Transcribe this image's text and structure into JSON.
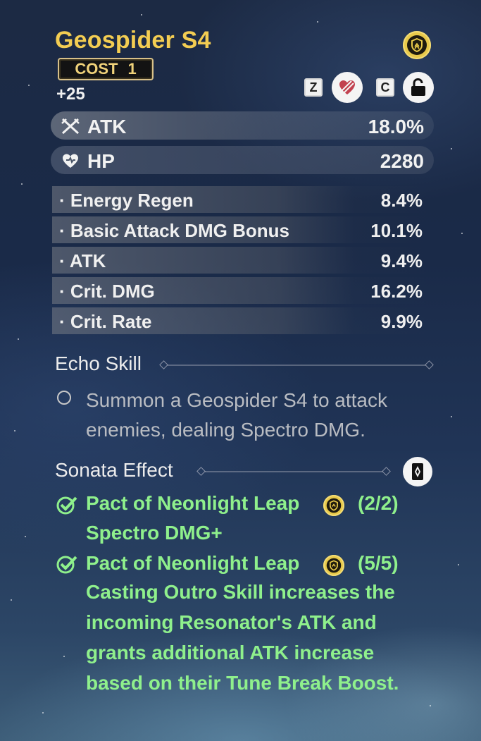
{
  "echo": {
    "name": "Geospider S4",
    "cost_label": "COST",
    "cost_value": "1",
    "level": "+25"
  },
  "controls": {
    "discard_key": "Z",
    "lock_key": "C"
  },
  "main_stats": [
    {
      "name": "ATK",
      "value": "18.0%",
      "icon": "swords-icon"
    },
    {
      "name": "HP",
      "value": "2280",
      "icon": "heart-icon"
    }
  ],
  "sub_stats": [
    {
      "name": "· Energy Regen",
      "value": "8.4%"
    },
    {
      "name": "· Basic Attack DMG Bonus",
      "value": "10.1%"
    },
    {
      "name": "· ATK",
      "value": "9.4%"
    },
    {
      "name": "· Crit. DMG",
      "value": "16.2%"
    },
    {
      "name": "· Crit. Rate",
      "value": "9.9%"
    }
  ],
  "echo_skill": {
    "heading": "Echo Skill",
    "description": "Summon a Geospider S4 to attack enemies, dealing Spectro DMG."
  },
  "sonata": {
    "heading": "Sonata Effect",
    "effects": [
      {
        "name": "Pact of Neonlight Leap",
        "count": "(2/2)",
        "description": "Spectro DMG+"
      },
      {
        "name": "Pact of Neonlight Leap",
        "count": "(5/5)",
        "description": "Casting Outro Skill increases the incoming Resonator's ATK and grants additional ATK increase based on their Tune Break Boost."
      }
    ]
  },
  "colors": {
    "title": "#f3cd52",
    "active_effect": "#8ff08c",
    "set_badge": "#e8c94a",
    "discard_mark": "#c2414f"
  }
}
